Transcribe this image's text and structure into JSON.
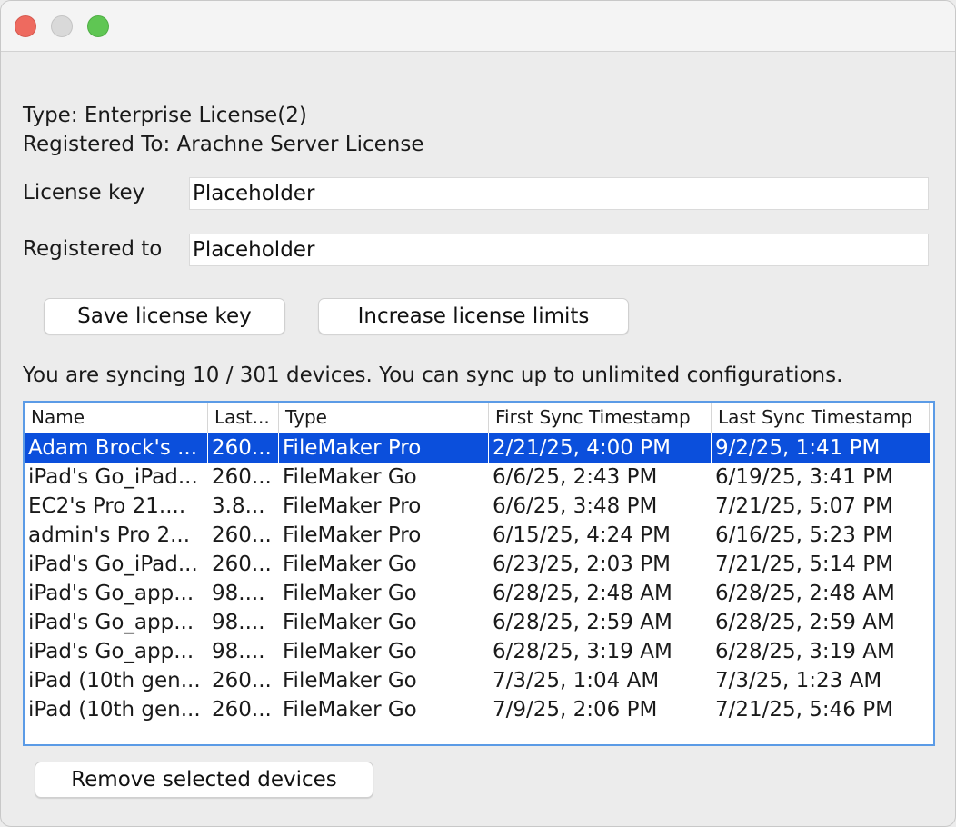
{
  "license": {
    "type_line": "Type: Enterprise License(2)",
    "registered_line": "Registered To: Arachne Server License"
  },
  "form": {
    "license_key_label": "License key",
    "license_key_value": "Placeholder",
    "registered_to_label": "Registered to",
    "registered_to_value": "Placeholder"
  },
  "buttons": {
    "save": "Save license key",
    "increase": "Increase license limits",
    "remove": "Remove selected devices"
  },
  "sync_status": "You are syncing 10 / 301 devices. You can sync up to unlimited configurations.",
  "table": {
    "columns": [
      "Name",
      "Last...",
      "Type",
      "First Sync Timestamp",
      "Last Sync Timestamp"
    ],
    "rows": [
      {
        "name": "Adam Brock's ...",
        "last": "260...",
        "type": "FileMaker Pro",
        "first": "2/21/25, 4:00 PM",
        "last_sync": "9/2/25, 1:41 PM",
        "selected": true
      },
      {
        "name": "iPad's Go_iPad...",
        "last": "260...",
        "type": "FileMaker Go",
        "first": "6/6/25, 2:43 PM",
        "last_sync": "6/19/25, 3:41 PM",
        "selected": false
      },
      {
        "name": "EC2's Pro 21....",
        "last": "3.8...",
        "type": "FileMaker Pro",
        "first": "6/6/25, 3:48 PM",
        "last_sync": "7/21/25, 5:07 PM",
        "selected": false
      },
      {
        "name": "admin's Pro 2...",
        "last": "260...",
        "type": "FileMaker Pro",
        "first": "6/15/25, 4:24 PM",
        "last_sync": "6/16/25, 5:23 PM",
        "selected": false
      },
      {
        "name": "iPad's Go_iPad...",
        "last": "260...",
        "type": "FileMaker Go",
        "first": "6/23/25, 2:03 PM",
        "last_sync": "7/21/25, 5:14 PM",
        "selected": false
      },
      {
        "name": "iPad's Go_app...",
        "last": "98....",
        "type": "FileMaker Go",
        "first": "6/28/25, 2:48 AM",
        "last_sync": "6/28/25, 2:48 AM",
        "selected": false
      },
      {
        "name": "iPad's Go_app...",
        "last": "98....",
        "type": "FileMaker Go",
        "first": "6/28/25, 2:59 AM",
        "last_sync": "6/28/25, 2:59 AM",
        "selected": false
      },
      {
        "name": "iPad's Go_app...",
        "last": "98....",
        "type": "FileMaker Go",
        "first": "6/28/25, 3:19 AM",
        "last_sync": "6/28/25, 3:19 AM",
        "selected": false
      },
      {
        "name": "iPad (10th gen...",
        "last": "260...",
        "type": "FileMaker Go",
        "first": "7/3/25, 1:04 AM",
        "last_sync": "7/3/25, 1:23 AM",
        "selected": false
      },
      {
        "name": "iPad (10th gen...",
        "last": "260...",
        "type": "FileMaker Go",
        "first": "7/9/25, 2:06 PM",
        "last_sync": "7/21/25, 5:46 PM",
        "selected": false
      }
    ]
  },
  "colors": {
    "selection": "#0b4fdc",
    "table_focus_border": "#5b9be6",
    "close_button": "#ee6a5f",
    "zoom_button": "#5fc653"
  }
}
